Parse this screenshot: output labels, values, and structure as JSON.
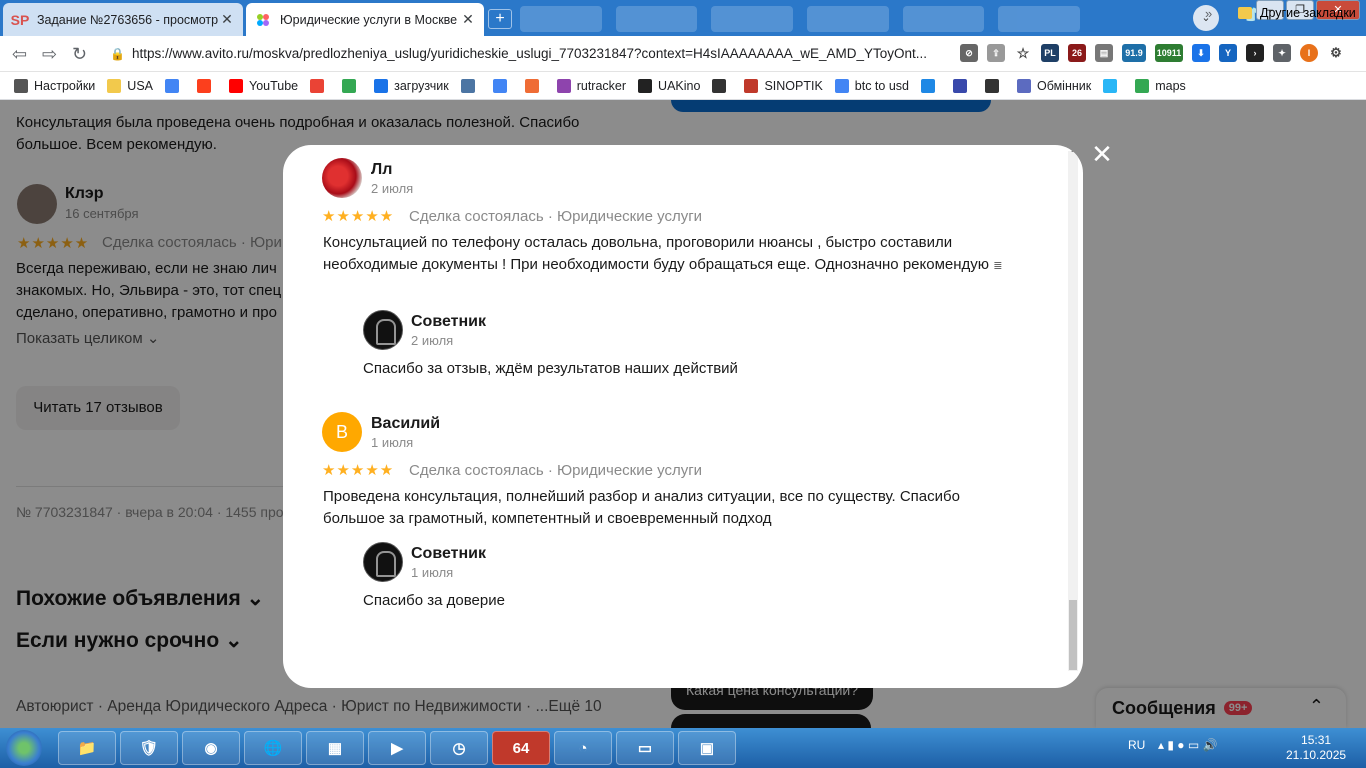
{
  "browser": {
    "tabs": [
      {
        "favicon": "SP",
        "title": "Задание №2763656 - просмотр з",
        "active": false
      },
      {
        "favicon": "avito-icon",
        "title": "Юридические услуги в Москве |",
        "active": true
      }
    ],
    "url": "https://www.avito.ru/moskva/predlozheniya_uslug/yuridicheskie_uslugi_7703231847?context=H4sIAAAAAAAA_wE_AMD_YToyOnt...",
    "ext_badges": {
      "pl": "PL",
      "count26": "26",
      "temp": "91.9",
      "num": "10911"
    },
    "bookmarks": [
      {
        "label": "Настройки",
        "icon": "gear-icon",
        "color": "#555555"
      },
      {
        "label": "USA",
        "icon": "folder-icon",
        "color": "#f2c94c"
      },
      {
        "label": "",
        "icon": "google-icon",
        "color": "#4285f4"
      },
      {
        "label": "",
        "icon": "yandex-icon",
        "color": "#fc3f1d"
      },
      {
        "label": "YouTube",
        "icon": "youtube-icon",
        "color": "#ff0000"
      },
      {
        "label": "",
        "icon": "gmail-icon",
        "color": "#ea4335"
      },
      {
        "label": "",
        "icon": "drive-icon",
        "color": "#34a853"
      },
      {
        "label": "загрузчик",
        "icon": "infinity-icon",
        "color": "#1a73e8"
      },
      {
        "label": "",
        "icon": "vk-icon",
        "color": "#4c75a3"
      },
      {
        "label": "",
        "icon": "translate-icon",
        "color": "#4285f4"
      },
      {
        "label": "",
        "icon": "f-icon",
        "color": "#ef6c35"
      },
      {
        "label": "rutracker",
        "icon": "rutracker-icon",
        "color": "#8e44ad"
      },
      {
        "label": "UAKino",
        "icon": "uakino-icon",
        "color": "#222222"
      },
      {
        "label": "",
        "icon": "figure-icon",
        "color": "#333333"
      },
      {
        "label": "SINOPTIK",
        "icon": "thermometer-icon",
        "color": "#c0392b"
      },
      {
        "label": "btc to usd",
        "icon": "google-icon",
        "color": "#4285f4"
      },
      {
        "label": "",
        "icon": "p-icon",
        "color": "#1e88e5"
      },
      {
        "label": "",
        "icon": "arrow-icon",
        "color": "#3949ab"
      },
      {
        "label": "",
        "icon": "bc-icon",
        "color": "#333333"
      },
      {
        "label": "Обмінник",
        "icon": "diamond-icon",
        "color": "#5c6bc0"
      },
      {
        "label": "",
        "icon": "snowflake-icon",
        "color": "#29b6f6"
      },
      {
        "label": "maps",
        "icon": "map-pin-icon",
        "color": "#34a853"
      }
    ],
    "bookmarks_more": "»",
    "other_bookmarks": "Другие закладки"
  },
  "page": {
    "prev_review_text": "Консультация была проведена очень подробная и оказалась полезной. Спасибо большое. Всем рекомендую.",
    "bg_review": {
      "name": "Клэр",
      "date": "16 сентября",
      "stars": "★★★★★",
      "deal": "Сделка состоялась · Юри",
      "text": "Всегда переживаю, если не знаю лич знакомых. Но, Эльвира - это, тот спец сделано, оперативно, грамотно и про",
      "show_more": "Показать целиком ⌄"
    },
    "read_reviews": "Читать 17 отзывов",
    "meta": "№ 7703231847 · вчера в 20:04 · 1455 прос",
    "similar": "Похожие объявления ⌄",
    "urgent": "Если нужно срочно ⌄",
    "categories": "Автоюрист · Аренда Юридического Адреса · Юрист по Недвижимости · ...Ещё 10",
    "chips": [
      "Какая цена консультации?",
      ""
    ],
    "messages": {
      "label": "Сообщения",
      "badge": "99+",
      "chevron": "⌃"
    }
  },
  "modal": {
    "close": "✕",
    "reviews": [
      {
        "name": "Лл",
        "date": "2 июля",
        "stars": "★★★★★",
        "deal": "Сделка состоялась · Юридические услуги",
        "text": "Консультацией по телефону осталась довольна, проговорили нюансы , быстро составили необходимые документы ! При необходимости буду обращаться еще. Однозначно рекомендую",
        "emoji": "≣",
        "reply": {
          "name": "Советник",
          "date": "2 июля",
          "text": "Спасибо за отзыв, ждём результатов наших действий"
        }
      },
      {
        "name": "Василий",
        "avatar_letter": "В",
        "date": "1 июля",
        "stars": "★★★★★",
        "deal": "Сделка состоялась · Юридические услуги",
        "text": "Проведена консультация, полнейший разбор и анализ ситуации, все по существу. Спасибо большое за грамотный, компетентный и своевременный подход",
        "reply": {
          "name": "Советник",
          "date": "1 июля",
          "text": "Спасибо за доверие"
        }
      }
    ]
  },
  "taskbar": {
    "apps": [
      "folder-app",
      "shield-app",
      "chrome-app",
      "globe-app",
      "monitor-app",
      "media-app",
      "clock-app",
      "64",
      "chart-app",
      "notepad-app",
      "terminal-app"
    ],
    "lang": "RU",
    "time": "15:31",
    "date": "21.10.2025"
  },
  "colors": {
    "star": "#ffb021",
    "accent_blue": "#0a6ed1",
    "badge_red": "#ff4053",
    "tabstrip": "#2b78c9"
  }
}
